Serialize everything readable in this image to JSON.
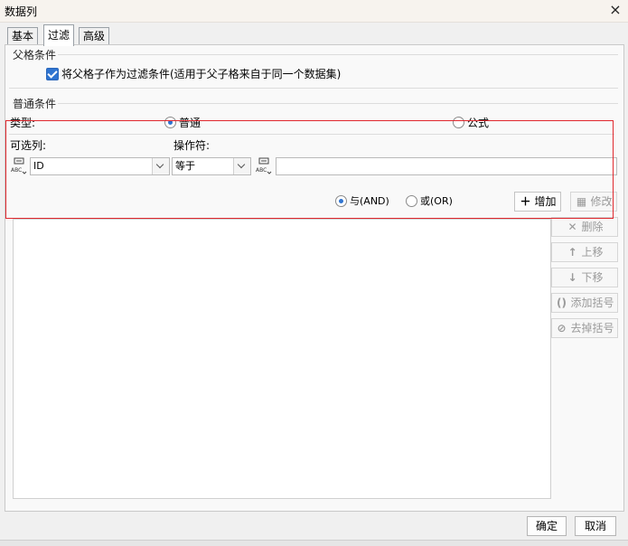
{
  "window": {
    "title": "数据列",
    "close_icon": "×"
  },
  "tabs": [
    {
      "label": "基本"
    },
    {
      "label": "过滤"
    },
    {
      "label": "高级"
    }
  ],
  "parent_condition": {
    "section_label": "父格条件",
    "checkbox_label": "将父格子作为过滤条件(适用于父子格来自于同一个数据集)",
    "checked": true
  },
  "common_condition": {
    "section_label": "普通条件",
    "type_label": "类型:",
    "type_options": [
      {
        "label": "普通",
        "selected": true
      },
      {
        "label": "公式",
        "selected": false
      }
    ],
    "column_label": "可选列:",
    "column_value": "ID",
    "operator_label": "操作符:",
    "operator_value": "等于",
    "value_input": "",
    "logic_options": [
      {
        "label": "与(AND)",
        "selected": true
      },
      {
        "label": "或(OR)",
        "selected": false
      }
    ]
  },
  "side_buttons": {
    "add": "增加",
    "modify": "修改",
    "delete": "删除",
    "move_up": "上移",
    "move_down": "下移",
    "add_bracket": "添加括号",
    "remove_bracket": "去掉括号"
  },
  "footer": {
    "ok": "确定",
    "cancel": "取消"
  },
  "colors": {
    "accent": "#2f74d0",
    "highlight_border": "#e0282e"
  }
}
